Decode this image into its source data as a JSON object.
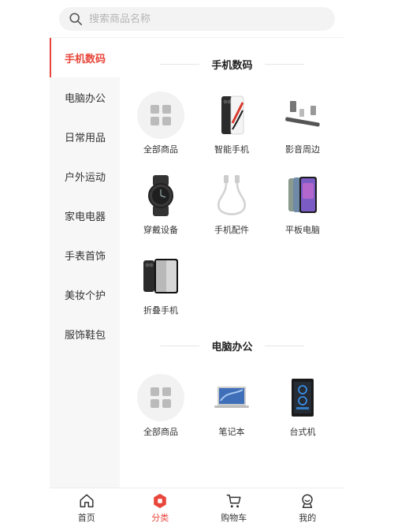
{
  "search": {
    "placeholder": "搜索商品名称"
  },
  "sidebar": {
    "items": [
      {
        "label": "手机数码",
        "active": true
      },
      {
        "label": "电脑办公"
      },
      {
        "label": "日常用品"
      },
      {
        "label": "户外运动"
      },
      {
        "label": "家电电器"
      },
      {
        "label": "手表首饰"
      },
      {
        "label": "美妆个护"
      },
      {
        "label": "服饰鞋包"
      }
    ]
  },
  "sections": [
    {
      "title": "手机数码",
      "items": [
        {
          "label": "全部商品",
          "icon": "all-products-icon"
        },
        {
          "label": "智能手机",
          "icon": "smartphone-icon"
        },
        {
          "label": "影音周边",
          "icon": "audio-accessories-icon"
        },
        {
          "label": "穿戴设备",
          "icon": "smartwatch-icon"
        },
        {
          "label": "手机配件",
          "icon": "cable-icon"
        },
        {
          "label": "平板电脑",
          "icon": "tablet-icon"
        },
        {
          "label": "折叠手机",
          "icon": "foldable-phone-icon"
        }
      ]
    },
    {
      "title": "电脑办公",
      "items": [
        {
          "label": "全部商品",
          "icon": "all-products-icon"
        },
        {
          "label": "笔记本",
          "icon": "laptop-icon"
        },
        {
          "label": "台式机",
          "icon": "desktop-pc-icon"
        }
      ]
    }
  ],
  "tabbar": {
    "items": [
      {
        "label": "首页",
        "icon": "home-icon"
      },
      {
        "label": "分类",
        "icon": "category-icon",
        "active": true
      },
      {
        "label": "购物车",
        "icon": "cart-icon"
      },
      {
        "label": "我的",
        "icon": "profile-icon"
      }
    ]
  },
  "colors": {
    "accent": "#e8463a",
    "sidebar_bg": "#f7f7f7",
    "search_bg": "#f3f3f3"
  }
}
